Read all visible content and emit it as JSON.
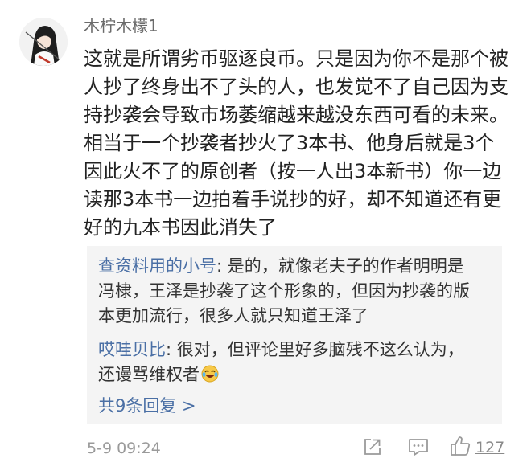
{
  "comment": {
    "username": "木柠木檬1",
    "text_lines": [
      "这就是所谓劣币驱逐良币。只是因为你不是那个被",
      "人抄了终身出不了头的人，也发觉不了自己因为支",
      "持抄袭会导致市场萎缩越来越没东西可看的未来。",
      "相当于一个抄袭者抄火了3本书、他身后就是3个",
      "因此火不了的原创者（按一人出3本新书）你一边",
      "读那3本书一边拍着手说抄的好，却不知道还有更",
      "好的九本书因此消失了"
    ],
    "replies": [
      {
        "user": "查资料用的小号",
        "separator": ": ",
        "lines": [
          "是的，就像老夫子的作者明明是",
          "冯棣，王泽是抄袭了这个形象的，但因为抄袭的版",
          "本更加流行，很多人就只知道王泽了"
        ]
      },
      {
        "user": "哎哇贝比",
        "separator": ": ",
        "lines": [
          "很对，但评论里好多脑残不这么认为，",
          "还谩骂维权者"
        ],
        "emoji": "laughing-tears-emoji"
      }
    ],
    "more_replies_label": "共9条回复 >",
    "timestamp": "5-9 09:24",
    "like_count": "127",
    "icons": {
      "share": "share-icon",
      "message": "message-icon",
      "like": "thumbs-up-icon"
    },
    "colors": {
      "link_blue": "#4a6fa5",
      "reply_bg": "#f4f4f4",
      "meta_gray": "#9a9a9a"
    }
  }
}
